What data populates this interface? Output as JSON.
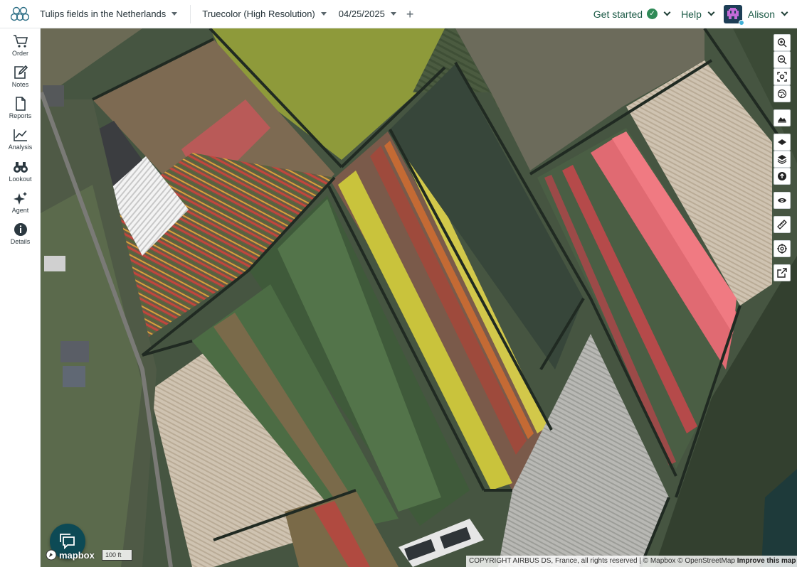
{
  "header": {
    "aoi_name": "Tulips fields in the Netherlands",
    "layer_name": "Truecolor (High Resolution)",
    "date": "04/25/2025",
    "add_label": "+",
    "get_started": "Get started",
    "help": "Help",
    "user_name": "Alison"
  },
  "sidebar": {
    "items": [
      {
        "label": "Order",
        "icon": "cart-icon"
      },
      {
        "label": "Notes",
        "icon": "notes-icon"
      },
      {
        "label": "Reports",
        "icon": "report-icon"
      },
      {
        "label": "Analysis",
        "icon": "chart-icon"
      },
      {
        "label": "Lookout",
        "icon": "binoculars-icon"
      },
      {
        "label": "Agent",
        "icon": "sparkle-icon"
      },
      {
        "label": "Details",
        "icon": "info-icon"
      }
    ]
  },
  "map": {
    "tools": [
      "zoom-in-icon",
      "zoom-out-icon",
      "fit-bounds-icon",
      "globe-icon",
      "terrain-icon",
      "layer-icon",
      "layers-stack-icon",
      "upload-icon",
      "visibility-icon",
      "ruler-icon",
      "target-icon",
      "external-link-icon"
    ],
    "mapbox_label": "mapbox",
    "scale_label": "100 ft",
    "attribution": "COPYRIGHT AIRBUS DS, France, all rights reserved | © Mapbox © OpenStreetMap",
    "improve_link": "Improve this map"
  },
  "colors": {
    "brand_dark": "#0d4a55",
    "accent_green": "#2f8a57",
    "link_green": "#1c5a46"
  }
}
